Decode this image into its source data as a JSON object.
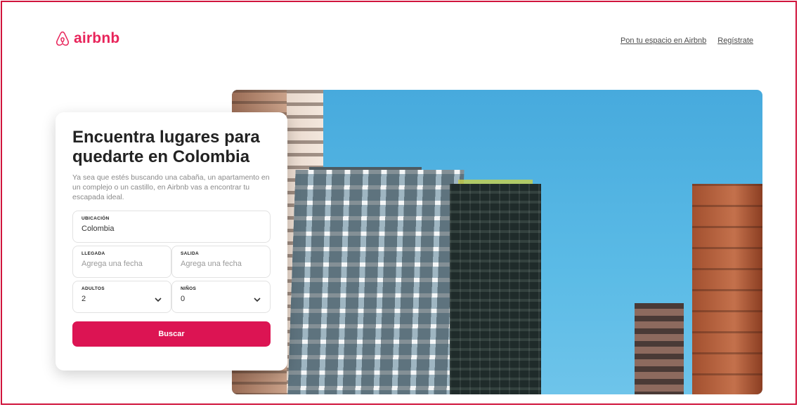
{
  "brand": {
    "name": "airbnb",
    "color": "#e8245a",
    "logo_icon": "airbnb-belo-icon"
  },
  "header": {
    "links": [
      "Pon tu espacio en Airbnb",
      "Regístrate"
    ]
  },
  "card": {
    "title": "Encuentra lugares para quedarte en Colombia",
    "subtitle": "Ya sea que estés buscando una cabaña, un apartamento en un complejo o un castillo, en Airbnb vas a encontrar tu escapada ideal.",
    "location": {
      "label": "UBICACIÓN",
      "value": "Colombia"
    },
    "checkin": {
      "label": "LLEGADA",
      "placeholder": "Agrega una fecha"
    },
    "checkout": {
      "label": "SALIDA",
      "placeholder": "Agrega una fecha"
    },
    "adults": {
      "label": "ADULTOS",
      "value": "2",
      "icon": "chevron-down-icon"
    },
    "children": {
      "label": "NIÑOS",
      "value": "0",
      "icon": "chevron-down-icon"
    },
    "search_label": "Buscar",
    "accent": "#dc1453"
  },
  "frame_color": "#d0143c"
}
